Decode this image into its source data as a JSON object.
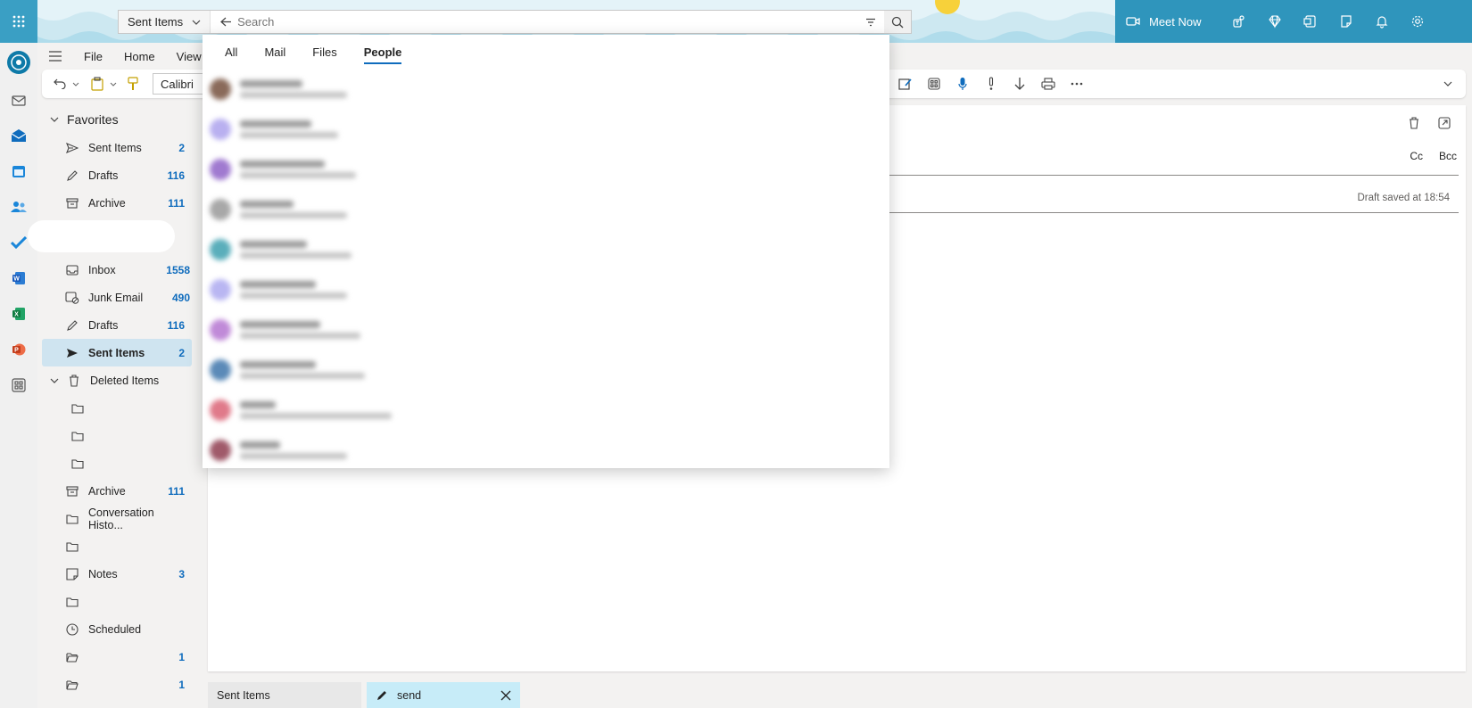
{
  "header": {
    "scope_label": "Sent Items",
    "meet_now_label": "Meet Now",
    "brand_color": "#2f95bc"
  },
  "search": {
    "placeholder": "Search",
    "value": ""
  },
  "menu": {
    "tabs": [
      "File",
      "Home",
      "View"
    ]
  },
  "ribbon": {
    "font_name": "Calibri"
  },
  "flyout": {
    "tabs": [
      "All",
      "Mail",
      "Files",
      "People"
    ],
    "active_tab": "People",
    "people_avatar_colors": [
      "#8a6a5a",
      "#b9b0f0",
      "#a07ad0",
      "#a8a8a8",
      "#5aaebb",
      "#b9b6f2",
      "#c08ad8",
      "#5b8ab8",
      "#e07a8a",
      "#a05a6a"
    ]
  },
  "folders": {
    "favorites_label": "Favorites",
    "favorites": [
      {
        "label": "Sent Items",
        "count": "2"
      },
      {
        "label": "Drafts",
        "count": "116"
      },
      {
        "label": "Archive",
        "count": "111"
      }
    ],
    "inbox": {
      "label": "Inbox",
      "count": "1558"
    },
    "junk": {
      "label": "Junk Email",
      "count": "490"
    },
    "drafts": {
      "label": "Drafts",
      "count": "116"
    },
    "sent": {
      "label": "Sent Items",
      "count": "2"
    },
    "deleted": {
      "label": "Deleted Items"
    },
    "archive": {
      "label": "Archive",
      "count": "111"
    },
    "conversation": {
      "label": "Conversation Histo..."
    },
    "notes": {
      "label": "Notes",
      "count": "3"
    },
    "scheduled": {
      "label": "Scheduled"
    },
    "extra_counts": [
      "1",
      "1"
    ]
  },
  "compose": {
    "cc_label": "Cc",
    "bcc_label": "Bcc",
    "draft_status": "Draft saved at 18:54"
  },
  "bottom_tabs": {
    "first": "Sent Items",
    "second": "send"
  }
}
